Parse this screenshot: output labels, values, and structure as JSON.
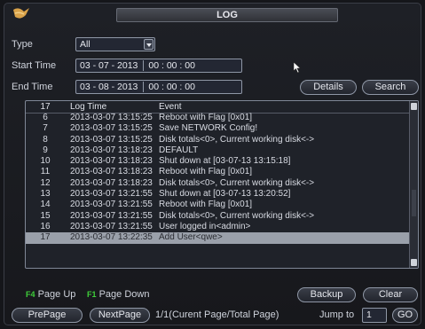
{
  "window": {
    "title": "LOG"
  },
  "filters": {
    "type_label": "Type",
    "type_value": "All",
    "start_label": "Start Time",
    "start_date": "03 - 07 - 2013",
    "start_time": "00 : 00 : 00",
    "end_label": "End Time",
    "end_date": "03 - 08 - 2013",
    "end_time": "00 : 00 : 00"
  },
  "buttons": {
    "details": "Details",
    "search": "Search",
    "backup": "Backup",
    "clear": "Clear",
    "prepage": "PrePage",
    "nextpage": "NextPage",
    "go": "GO"
  },
  "table": {
    "header": {
      "no": "17",
      "time": "Log Time",
      "event": "Event"
    },
    "rows": [
      {
        "no": "6",
        "time": "2013-03-07 13:15:25",
        "event": "Reboot with Flag [0x01]"
      },
      {
        "no": "7",
        "time": "2013-03-07 13:15:25",
        "event": "Save NETWORK Config!"
      },
      {
        "no": "8",
        "time": "2013-03-07 13:15:25",
        "event": "Disk totals<0>, Current working disk<->"
      },
      {
        "no": "9",
        "time": "2013-03-07 13:18:23",
        "event": "DEFAULT"
      },
      {
        "no": "10",
        "time": "2013-03-07 13:18:23",
        "event": "Shut down at [03-07-13 13:15:18]"
      },
      {
        "no": "11",
        "time": "2013-03-07 13:18:23",
        "event": "Reboot with Flag [0x01]"
      },
      {
        "no": "12",
        "time": "2013-03-07 13:18:23",
        "event": "Disk totals<0>, Current working disk<->"
      },
      {
        "no": "13",
        "time": "2013-03-07 13:21:55",
        "event": "Shut down at [03-07-13 13:20:52]"
      },
      {
        "no": "14",
        "time": "2013-03-07 13:21:55",
        "event": "Reboot with Flag [0x01]"
      },
      {
        "no": "15",
        "time": "2013-03-07 13:21:55",
        "event": "Disk totals<0>, Current working disk<->"
      },
      {
        "no": "16",
        "time": "2013-03-07 13:21:55",
        "event": "User logged in<admin>"
      },
      {
        "no": "17",
        "time": "2013-03-07 13:22:35",
        "event": "Add User<qwe>"
      }
    ]
  },
  "footer": {
    "page_up_key": "F4",
    "page_up_label": "Page Up",
    "page_down_key": "F1",
    "page_down_label": "Page Down",
    "page_info": "1/1(Curent Page/Total Page)",
    "jump_label": "Jump to",
    "jump_value": "1"
  },
  "icons": {
    "logo": "logo-icon",
    "cursor": "mouse-cursor-icon"
  }
}
